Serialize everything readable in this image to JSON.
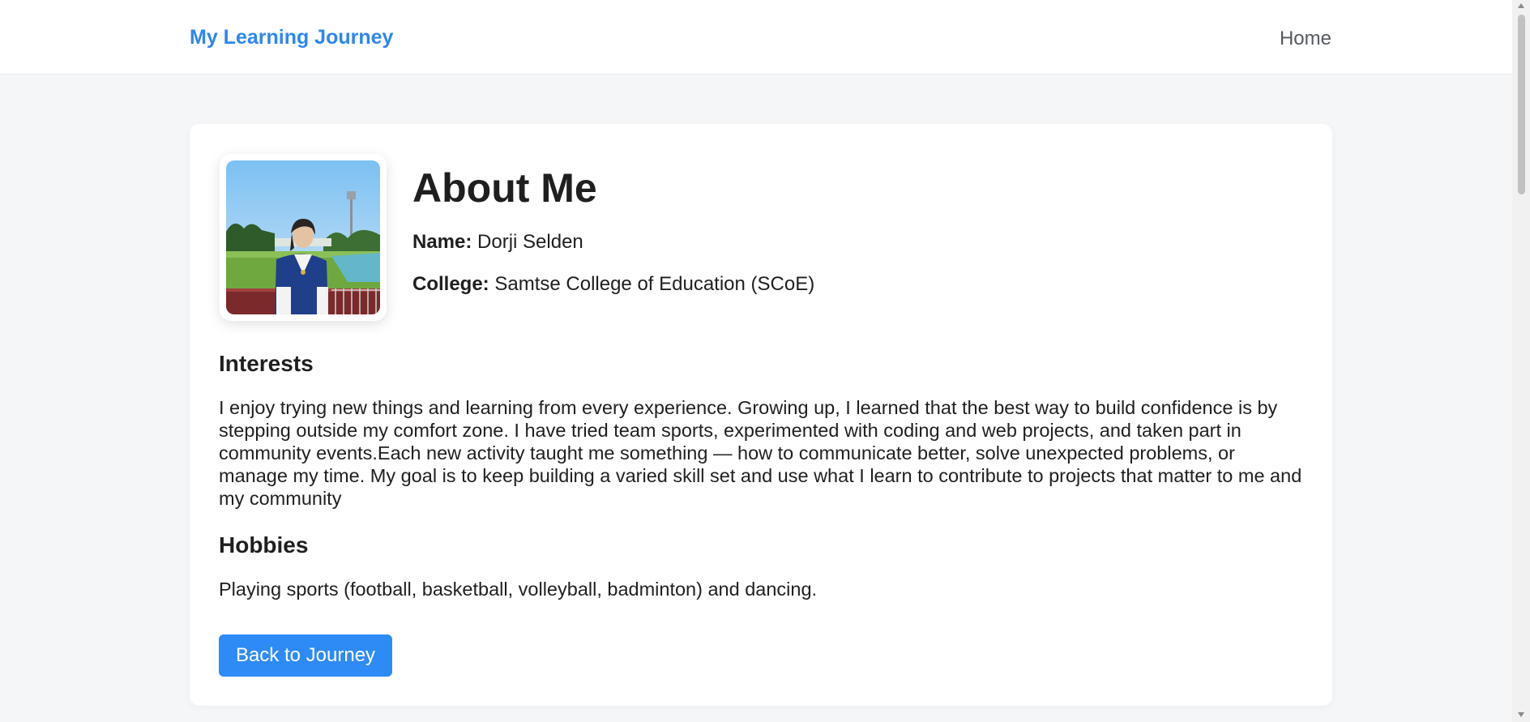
{
  "nav": {
    "brand": "My Learning Journey",
    "links": [
      "Home"
    ]
  },
  "about": {
    "title": "About Me",
    "name_label": "Name:",
    "name_value": "Dorji Selden",
    "college_label": "College:",
    "college_value": "Samtse College of Education (SCoE)"
  },
  "interests": {
    "heading": "Interests",
    "text": "I enjoy trying new things and learning from every experience. Growing up, I learned that the best way to build confidence is by stepping outside my comfort zone. I have tried team sports, experimented with coding and web projects, and taken part in community events.Each new activity taught me something — how to communicate better, solve unexpected problems, or manage my time. My goal is to keep building a varied skill set and use what I learn to contribute to projects that matter to me and my community"
  },
  "hobbies": {
    "heading": "Hobbies",
    "text": "Playing sports (football, basketball, volleyball, badminton) and dancing."
  },
  "actions": {
    "back_label": "Back to Journey"
  },
  "colors": {
    "accent": "#2e86f0",
    "button": "#2e8bf5",
    "page_bg": "#f5f6f8",
    "text": "#1f1f1f"
  }
}
